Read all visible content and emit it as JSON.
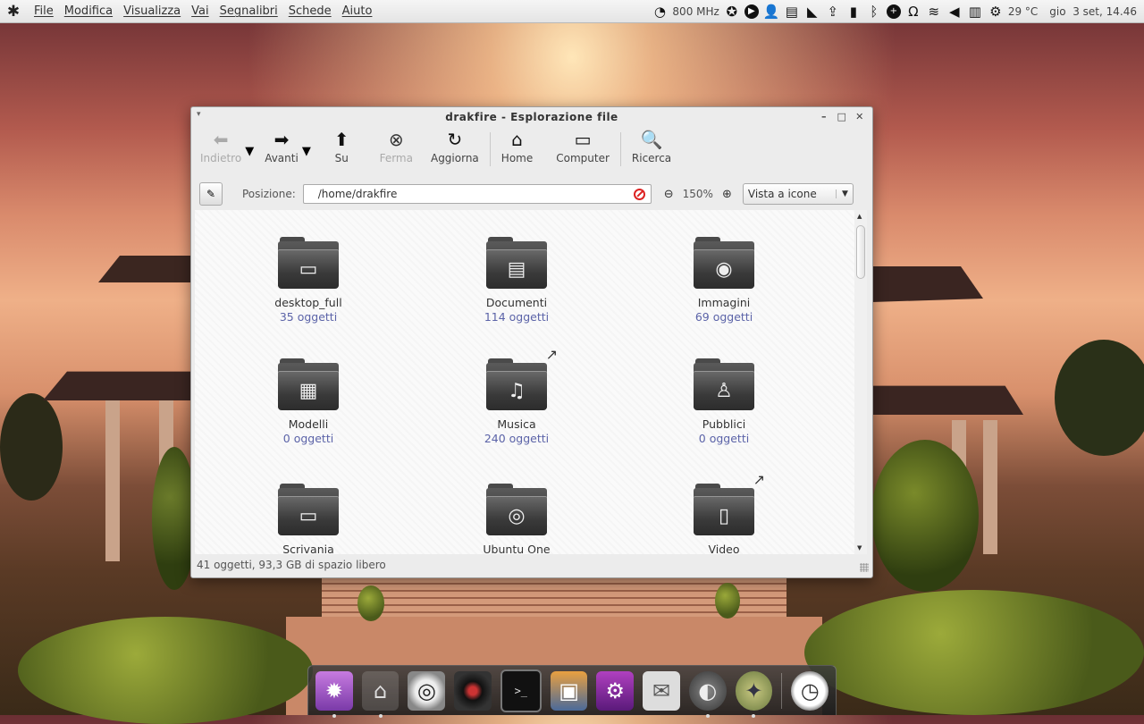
{
  "panel": {
    "menus": [
      "File",
      "Modifica",
      "Visualizza",
      "Vai",
      "Segnalibri",
      "Schede",
      "Aiuto"
    ],
    "cpu_freq": "800 MHz",
    "temperature": "29 °C",
    "clock": "gio  3 set, 14.46",
    "tray_icons": [
      "speedometer-icon",
      "ubuntu-one-icon",
      "play-icon",
      "user-icon",
      "printer-icon",
      "rss-icon",
      "update-icon",
      "battery-icon",
      "bluetooth-icon",
      "add-icon",
      "headphones-icon",
      "wifi-icon",
      "volume-icon",
      "trash-icon",
      "gear-icon"
    ]
  },
  "window": {
    "title": "drakfire - Esplorazione file",
    "toolbar": {
      "back": "Indietro",
      "forward": "Avanti",
      "up": "Su",
      "stop": "Ferma",
      "reload": "Aggiorna",
      "home": "Home",
      "computer": "Computer",
      "search": "Ricerca"
    },
    "location": {
      "label": "Posizione:",
      "path": "/home/drakfire",
      "zoom": "150%",
      "view_mode": "Vista a icone"
    },
    "items": [
      {
        "name": "desktop_full",
        "count": "35 oggetti",
        "icon": "desktop-folder-icon"
      },
      {
        "name": "Documenti",
        "count": "114 oggetti",
        "icon": "documents-folder-icon"
      },
      {
        "name": "Immagini",
        "count": "69 oggetti",
        "icon": "pictures-folder-icon"
      },
      {
        "name": "Modelli",
        "count": "0 oggetti",
        "icon": "templates-folder-icon"
      },
      {
        "name": "Musica",
        "count": "240 oggetti",
        "icon": "music-folder-icon"
      },
      {
        "name": "Pubblici",
        "count": "0 oggetti",
        "icon": "public-folder-icon"
      },
      {
        "name": "Scrivania",
        "count": "",
        "icon": "desktop-folder-icon"
      },
      {
        "name": "Ubuntu One",
        "count": "",
        "icon": "ubuntu-one-folder-icon"
      },
      {
        "name": "Video",
        "count": "",
        "icon": "video-folder-icon"
      }
    ],
    "status": "41 oggetti, 93,3 GB di spazio libero"
  },
  "dock": {
    "items": [
      "launcher-icon",
      "home-folder-icon",
      "music-player-icon",
      "camera-icon",
      "terminal-icon",
      "photo-viewer-icon",
      "graphics-editor-icon",
      "mail-icon",
      "firefox-icon",
      "safari-compass-icon",
      "clock-icon"
    ]
  }
}
